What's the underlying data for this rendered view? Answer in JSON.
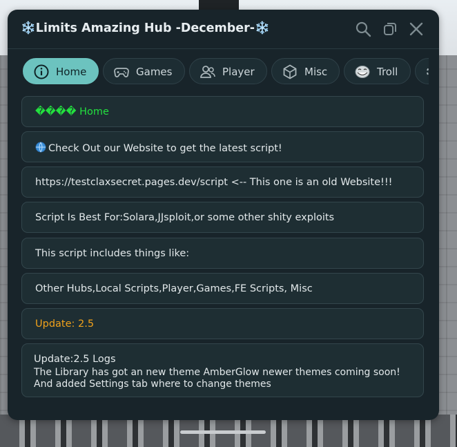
{
  "window": {
    "title": "❄️Limits Amazing Hub -December-❄️"
  },
  "tabs": [
    {
      "label": "Home",
      "icon": "info-icon",
      "active": true
    },
    {
      "label": "Games",
      "icon": "gamepad-icon",
      "active": false
    },
    {
      "label": "Player",
      "icon": "users-icon",
      "active": false
    },
    {
      "label": "Misc",
      "icon": "cube-icon",
      "active": false
    },
    {
      "label": "Troll",
      "icon": "trollface-icon",
      "active": false
    }
  ],
  "rows": [
    {
      "text": "���� Home"
    },
    {
      "text": "Check Out our Website to get the latest script!"
    },
    {
      "text": "https://testclaxsecret.pages.dev/script <-- This one is an old Website!!!"
    },
    {
      "text": "Script Is Best For:Solara,JJsploit,or some other shity exploits"
    },
    {
      "text": "This script includes things like:"
    },
    {
      "text": "Other Hubs,Local Scripts,Player,Games,FE Scripts, Misc"
    },
    {
      "text": "Update: 2.5"
    }
  ],
  "log": {
    "title": "Update:2.5 Logs",
    "body": "The Library has got an new theme AmberGlow  newer themes coming soon! And added Settings tab where to change themes"
  },
  "colors": {
    "accent": "#6cc3bf",
    "green_text": "#23e03f",
    "orange_text": "#f1a21b",
    "window_bg": "#18242a"
  }
}
